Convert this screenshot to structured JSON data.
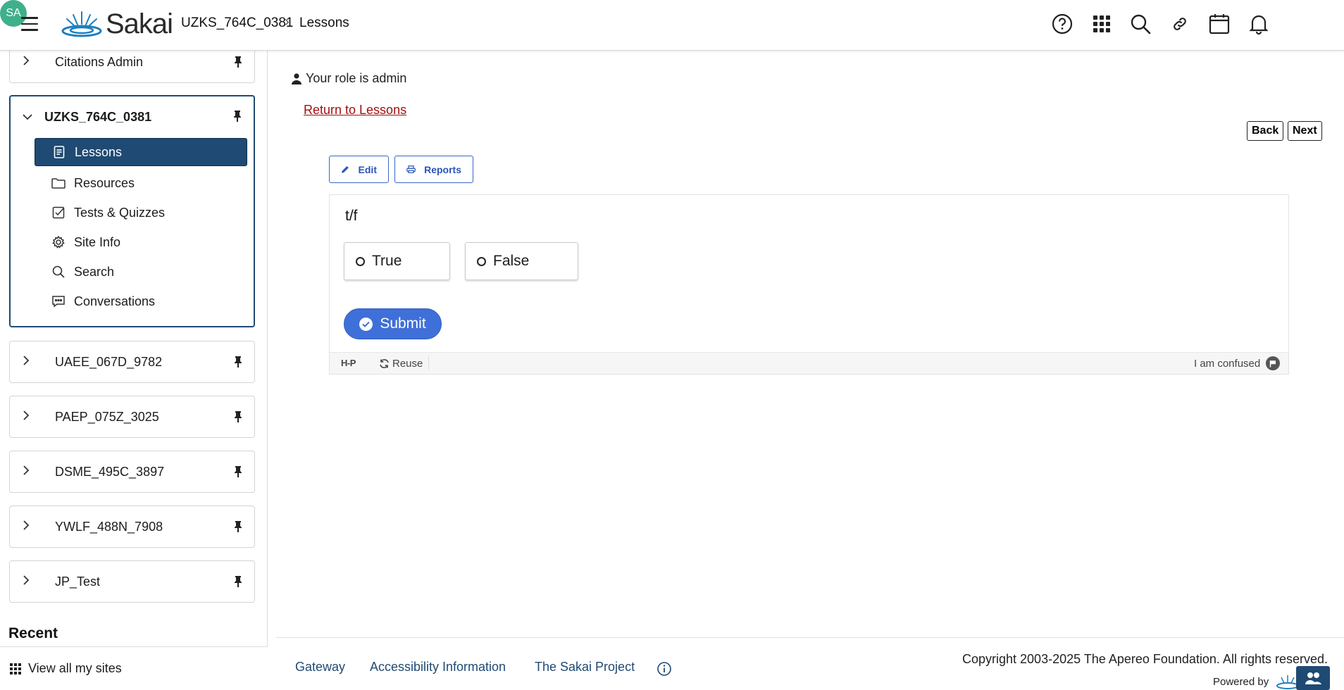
{
  "header": {
    "logo_text": "Sakai",
    "breadcrumb_site": "UZKS_764C_0381",
    "breadcrumb_sep": "›",
    "breadcrumb_page": "Lessons",
    "avatar_initials": "SA",
    "icons": [
      "help-icon",
      "apps-grid-icon",
      "search-icon",
      "link-icon",
      "calendar-icon",
      "bell-icon"
    ]
  },
  "sidebar": {
    "sites": [
      {
        "name": "Citations Admin",
        "expanded": false
      },
      {
        "name": "UZKS_764C_0381",
        "expanded": true
      },
      {
        "name": "UAEE_067D_9782",
        "expanded": false
      },
      {
        "name": "PAEP_075Z_3025",
        "expanded": false
      },
      {
        "name": "DSME_495C_3897",
        "expanded": false
      },
      {
        "name": "YWLF_488N_7908",
        "expanded": false
      },
      {
        "name": "JP_Test",
        "expanded": false
      }
    ],
    "tools": [
      {
        "label": "Lessons",
        "icon": "lessons-icon",
        "selected": true
      },
      {
        "label": "Resources",
        "icon": "folder-icon",
        "selected": false
      },
      {
        "label": "Tests & Quizzes",
        "icon": "checkbox-icon",
        "selected": false
      },
      {
        "label": "Site Info",
        "icon": "gear-icon",
        "selected": false
      },
      {
        "label": "Search",
        "icon": "search-icon",
        "selected": false
      },
      {
        "label": "Conversations",
        "icon": "chat-icon",
        "selected": false
      }
    ],
    "recent_title": "Recent",
    "view_all": "View all my sites"
  },
  "main": {
    "role_text": "Your role is admin",
    "return_link": "Return to Lessons",
    "back_label": "Back",
    "next_label": "Next",
    "edit_label": "Edit",
    "reports_label": "Reports",
    "question": "t/f",
    "answers": [
      "True",
      "False"
    ],
    "submit_label": "Submit",
    "h5p_logo": "H-P",
    "reuse_label": "Reuse",
    "confused_label": "I am confused"
  },
  "footer": {
    "links": [
      "Gateway",
      "Accessibility Information",
      "The Sakai Project"
    ],
    "copyright": "Copyright 2003-2025 The Apereo Foundation. All rights reserved.",
    "powered_by": "Powered by"
  },
  "colors": {
    "primary_navy": "#1f4a73",
    "link_red": "#a20f10",
    "submit_blue": "#3f6fd8",
    "avatar_green": "#3fb08c"
  }
}
